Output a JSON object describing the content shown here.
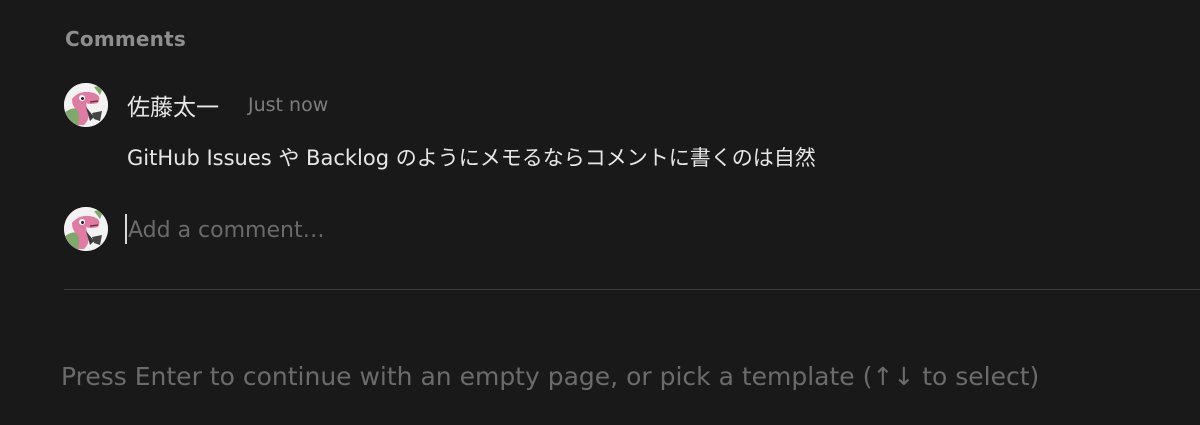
{
  "comments": {
    "heading": "Comments",
    "items": [
      {
        "author": "佐藤太一",
        "timestamp": "Just now",
        "text": "GitHub Issues や Backlog のようにメモるならコメントに書くのは自然",
        "avatar": "dinosaur-avatar-icon"
      }
    ],
    "composer": {
      "placeholder": "Add a comment…",
      "value": "",
      "avatar": "dinosaur-avatar-icon"
    }
  },
  "page": {
    "empty_hint": "Press Enter to continue with an empty page, or pick a template (↑↓ to select)"
  },
  "colors": {
    "background": "#191919",
    "text_primary": "#e6e6e6",
    "text_muted": "#7d7d7d",
    "avatar_pink": "#e07ba3",
    "avatar_green": "#7fa86a"
  }
}
